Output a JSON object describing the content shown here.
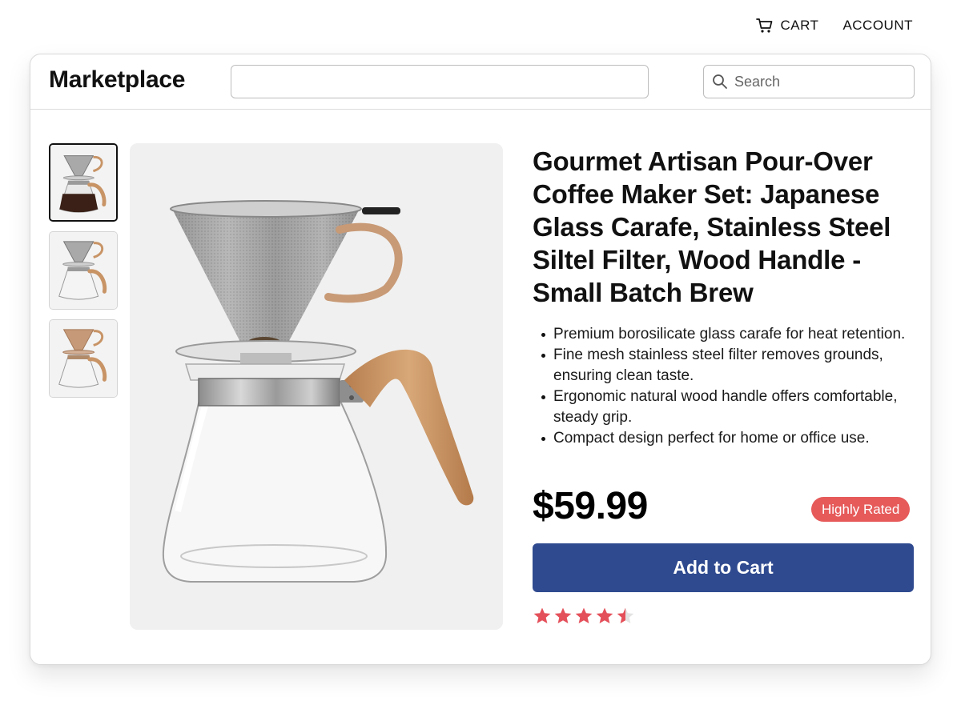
{
  "top_nav": {
    "cart_label": "CART",
    "account_label": "ACCOUNT",
    "cart_icon": "shopping-cart-icon"
  },
  "header": {
    "brand": "Marketplace",
    "wide_input_value": "",
    "search_placeholder": "Search",
    "search_icon": "search-icon"
  },
  "gallery": {
    "thumbnails": [
      {
        "variant": "glass-filter-with-coffee",
        "selected": true
      },
      {
        "variant": "glass-filter-empty",
        "selected": false
      },
      {
        "variant": "ceramic-dripper",
        "selected": false
      }
    ]
  },
  "product": {
    "title": "Gourmet Artisan Pour-Over Coffee Maker Set: Japanese Glass Carafe, Stainless Steel Siltel Filter, Wood Handle - Small Batch Brew",
    "features": [
      "Premium borosilicate glass carafe for heat retention.",
      "Fine mesh stainless steel filter removes grounds, ensuring clean taste.",
      "Ergonomic natural wood handle offers comfortable, steady grip.",
      "Compact design perfect for home or office use."
    ],
    "price": "$59.99",
    "badge": "Highly Rated",
    "add_to_cart_label": "Add to Cart",
    "rating": 4.5,
    "rating_max": 5
  },
  "colors": {
    "button_blue": "#2f4a8f",
    "badge_red": "#e65a5a",
    "star_red": "#e4505a",
    "wood": "#c89466"
  }
}
